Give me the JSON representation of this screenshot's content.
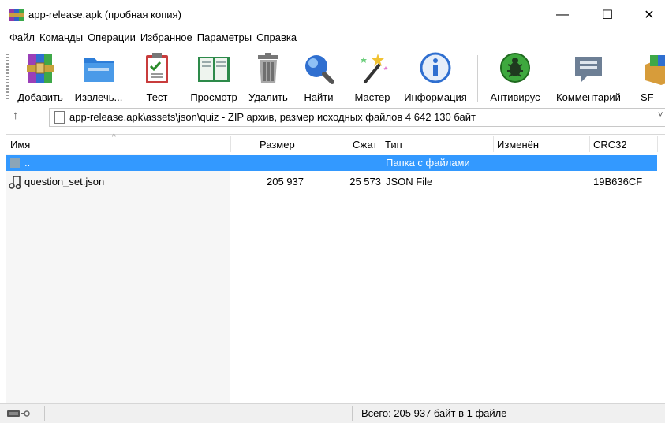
{
  "window": {
    "title": "app-release.apk (пробная копия)",
    "minimize": "—",
    "maximize": "☐",
    "close": "✕"
  },
  "menu": [
    "Файл",
    "Команды",
    "Операции",
    "Избранное",
    "Параметры",
    "Справка"
  ],
  "toolbar": {
    "add": "Добавить",
    "extract": "Извлечь...",
    "test": "Тест",
    "view": "Просмотр",
    "delete": "Удалить",
    "find": "Найти",
    "wizard": "Мастер",
    "info": "Информация",
    "antivirus": "Антивирус",
    "comment": "Комментарий",
    "sfx": "SF"
  },
  "address": {
    "up": "↑",
    "path": "app-release.apk\\assets\\json\\quiz - ZIP архив, размер исходных файлов 4 642 130 байт",
    "chevron": "˅"
  },
  "columns": {
    "name": "Имя",
    "size": "Размер",
    "packed": "Сжат",
    "type": "Тип",
    "modified": "Изменён",
    "crc": "CRC32",
    "sort_caret": "^"
  },
  "rows": [
    {
      "name": "..",
      "size": "",
      "packed": "",
      "type": "Папка с файлами",
      "modified": "",
      "crc": ""
    },
    {
      "name": "question_set.json",
      "size": "205 937",
      "packed": "25 573",
      "type": "JSON File",
      "modified": "",
      "crc": "19B636CF"
    }
  ],
  "status": {
    "total": "Всего: 205 937 байт в 1 файле"
  },
  "colors": {
    "selection": "#3399ff",
    "status_bg": "#f0f0f0"
  }
}
